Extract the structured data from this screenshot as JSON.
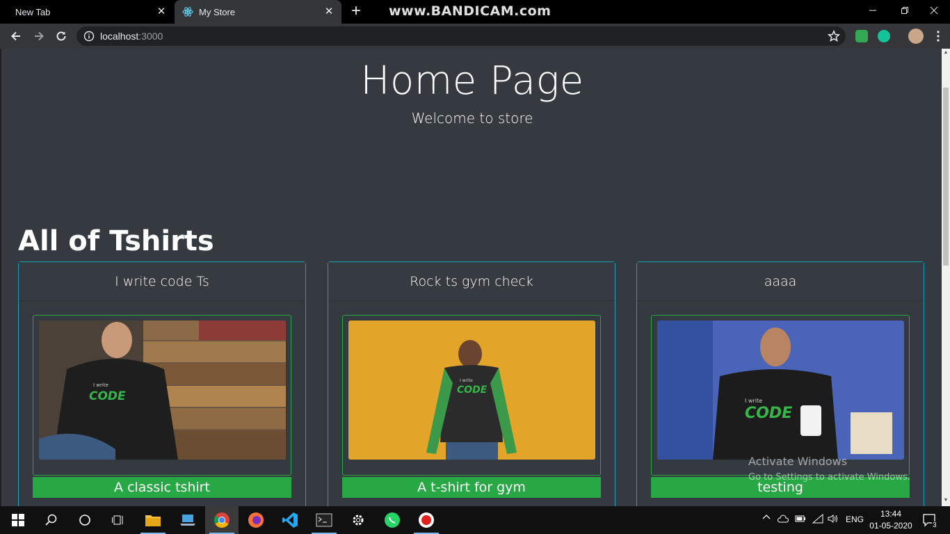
{
  "browser": {
    "tabs": [
      {
        "label": "New Tab"
      },
      {
        "label": "My Store"
      }
    ],
    "watermark": "www.BANDICAM.com",
    "url_host": "localhost",
    "url_port": ":3000"
  },
  "page": {
    "title": "Home Page",
    "subtitle": "Welcome to store",
    "section_title": "All of Tshirts",
    "products": [
      {
        "name": "I write code Ts",
        "description": "A classic tshirt"
      },
      {
        "name": "Rock ts gym check",
        "description": "A t-shirt for gym"
      },
      {
        "name": "aaaa",
        "description": "testing"
      }
    ]
  },
  "windows_overlay": {
    "line1": "Activate Windows",
    "line2": "Go to Settings to activate Windows."
  },
  "taskbar": {
    "language": "ENG",
    "time": "13:44",
    "date": "01-05-2020",
    "notification_count": "3"
  },
  "colors": {
    "page_bg": "#343a40",
    "card_border": "#17a2b8",
    "accent_green": "#28a745"
  }
}
